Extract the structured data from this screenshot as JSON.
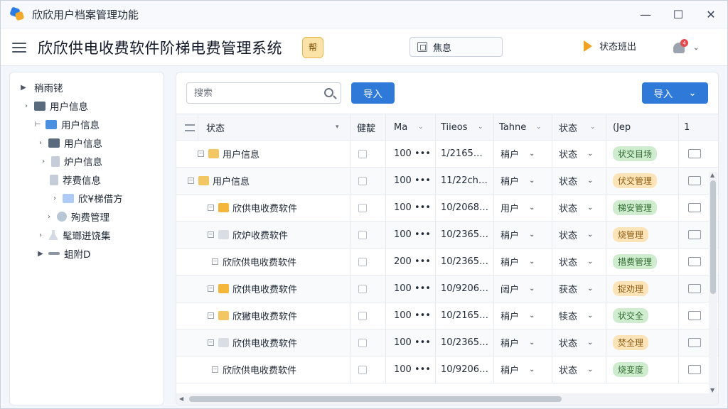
{
  "window": {
    "title": "欣欣用户档案管理功能",
    "controls": [
      "—",
      "☐",
      "✕"
    ]
  },
  "header": {
    "system_title": "欣欣供电收费软件阶梯电费管理系统",
    "badge_text": "帮",
    "info_label": "焦息",
    "status_link": "状态班出",
    "notification_count": "4"
  },
  "sidebar": {
    "items": [
      {
        "label": "稍雨铑",
        "arrow": "▶"
      },
      {
        "label": "用户信息",
        "arrow": "›"
      },
      {
        "label": "用户信息",
        "arrow": "⊢"
      },
      {
        "label": "用户信息",
        "arrow": "›"
      },
      {
        "label": "炉户信息",
        "arrow": "›"
      },
      {
        "label": "荐费信息",
        "arrow": ""
      },
      {
        "label": "欣¥梯借方",
        "arrow": "›"
      },
      {
        "label": "殉费管理",
        "arrow": "›"
      },
      {
        "label": "髦瑯迸饶集",
        "arrow": "›"
      },
      {
        "label": "蛆附D",
        "arrow": "▶"
      }
    ]
  },
  "toolbar": {
    "search_placeholder": "搜索",
    "import_label": "导入",
    "import2_label": "导入",
    "import2_chev": "⌄"
  },
  "table": {
    "headers": [
      "状态",
      "健靛",
      "Ma",
      "Tiieos",
      "Tahne",
      "状态",
      "(Jep",
      "1"
    ],
    "rows": [
      {
        "name": "用户信息",
        "t2": "1/2165…",
        "t3": "稍户",
        "t4": "状态",
        "val": "100 •••",
        "badge": "状交目场",
        "badge_color": "green"
      },
      {
        "name": "用户信息",
        "t2": "11/22ch…",
        "t3": "稍户",
        "t4": "状态",
        "val": "100 •••",
        "badge": "伏交管理",
        "badge_color": "orange"
      },
      {
        "name": "欣供电收费软件",
        "t2": "10/2068…",
        "t3": "用户",
        "t4": "状态",
        "val": "100 •••",
        "badge": "梯安管理",
        "badge_color": "green"
      },
      {
        "name": "欣炉收费软件",
        "t2": "10/2365…",
        "t3": "稍户",
        "t4": "状态",
        "val": "100 •••",
        "badge": "烧管理",
        "badge_color": "orange"
      },
      {
        "name": "欣欣供电收费软件",
        "t2": "10/2365…",
        "t3": "稍户",
        "t4": "状态",
        "val": "200 •••",
        "badge": "措费管理",
        "badge_color": "green"
      },
      {
        "name": "欣供电收费软件",
        "t2": "10/9206…",
        "t3": "阔户",
        "t4": "获态",
        "val": "100 •••",
        "badge": "捉劝理",
        "badge_color": "orange"
      },
      {
        "name": "欣獙电收费软件",
        "t2": "10/2165…",
        "t3": "稍户",
        "t4": "犊态",
        "val": "100 •••",
        "badge": "状交全",
        "badge_color": "green"
      },
      {
        "name": "欣供电收费软件",
        "t2": "10/2365…",
        "t3": "稍户",
        "t4": "状态",
        "val": "100 •••",
        "badge": "焚全理",
        "badge_color": "orange"
      },
      {
        "name": "欣欣供电收费软件",
        "t2": "10/9206…",
        "t3": "稍户",
        "t4": "状态",
        "val": "100 •••",
        "badge": "烧变度",
        "badge_color": "green"
      }
    ]
  },
  "colors": {
    "accent": "#2f7ad8",
    "badge_green": "#cfeccf",
    "badge_orange": "#fde4b8"
  }
}
